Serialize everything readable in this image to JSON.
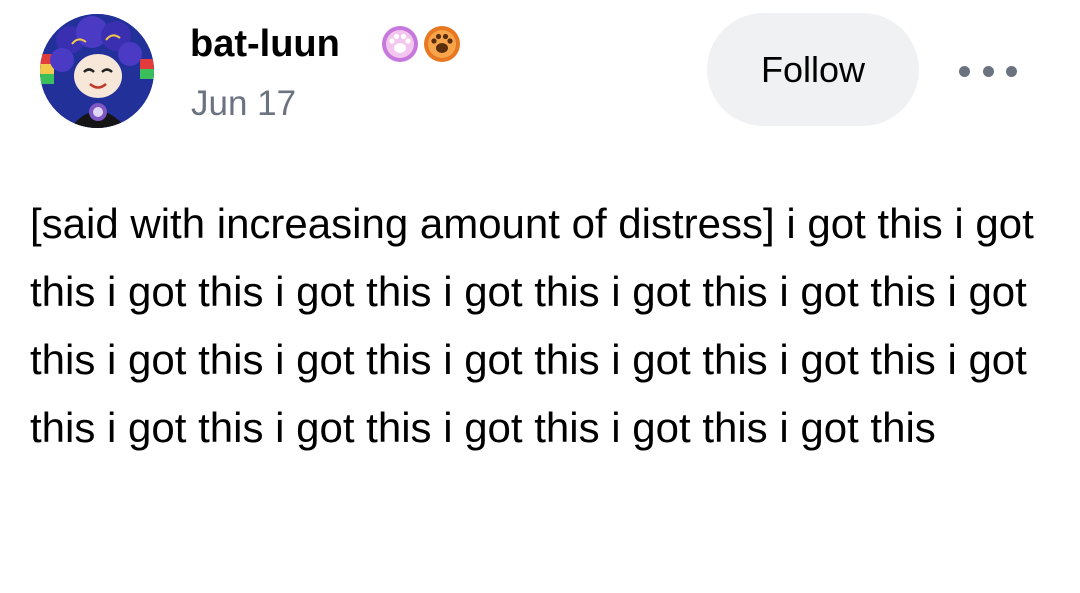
{
  "post": {
    "author": {
      "username": "bat-luun",
      "avatar_icon": "avatar-image",
      "badges": [
        {
          "icon": "paw-badge-icon",
          "color": "#c678dd"
        },
        {
          "icon": "paw-badge-icon",
          "color": "#e87722"
        }
      ]
    },
    "date": "Jun 17",
    "follow_label": "Follow",
    "more_icon": "more-options-icon",
    "body": "[said with increasing amount of distress] i got this i got this i got this i got this i got this i got this i got this i got this i got this i got this i got this i got this i got this i got this i got this i got this i got this i got this i got this"
  },
  "colors": {
    "follow_bg": "#f0f1f3",
    "date_text": "#6b7280",
    "dots": "#6b7280"
  }
}
